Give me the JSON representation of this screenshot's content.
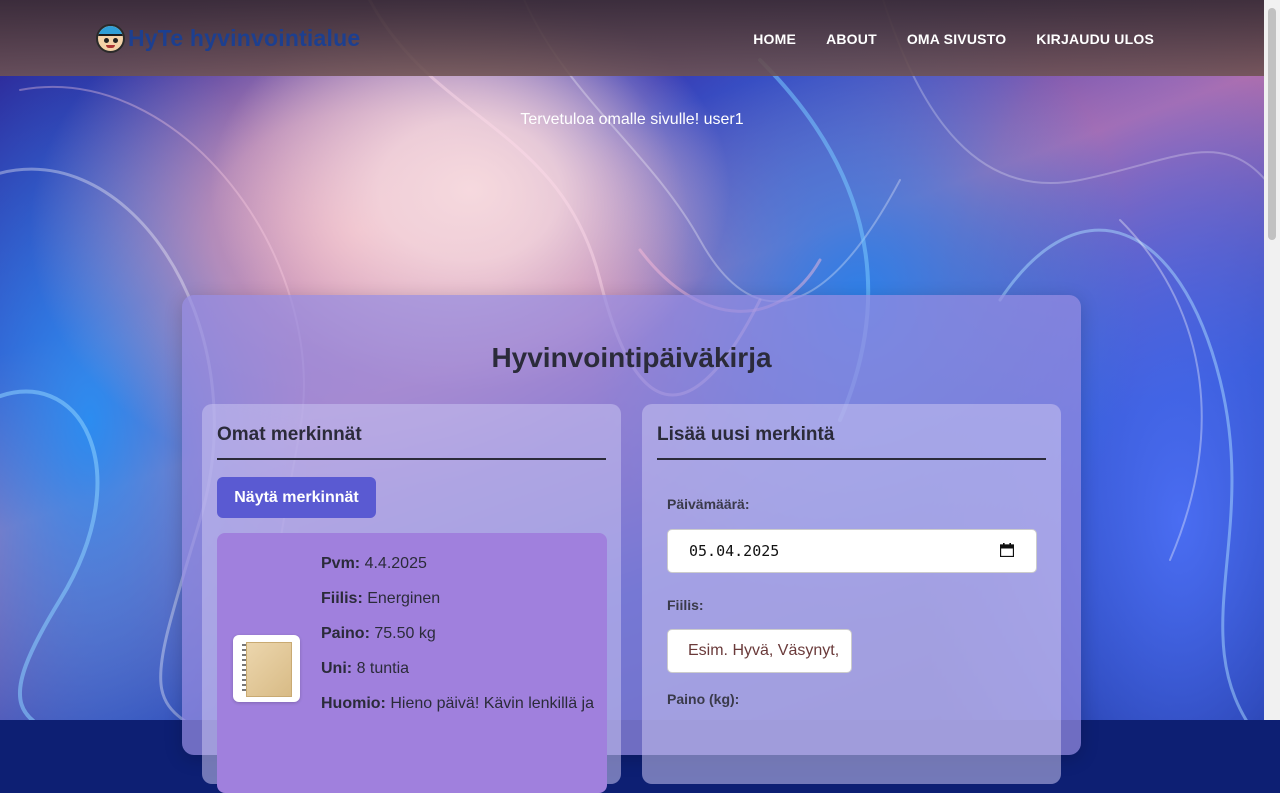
{
  "header": {
    "logo_text": "HyTe hyvinvointialue",
    "nav": [
      "HOME",
      "ABOUT",
      "OMA SIVUSTO",
      "KIRJAUDU ULOS"
    ]
  },
  "welcome": "Tervetuloa omalle sivulle! user1",
  "main": {
    "title": "Hyvinvointipäiväkirja",
    "entries_panel": {
      "title": "Omat merkinnät",
      "show_button": "Näytä merkinnät",
      "entry": {
        "fields": [
          {
            "label": "Pvm:",
            "value": "4.4.2025"
          },
          {
            "label": "Fiilis:",
            "value": "Energinen"
          },
          {
            "label": "Paino:",
            "value": "75.50 kg"
          },
          {
            "label": "Uni:",
            "value": "8 tuntia"
          },
          {
            "label": "Huomio:",
            "value": "Hieno päivä! Kävin lenkillä ja"
          }
        ]
      }
    },
    "new_entry_panel": {
      "title": "Lisää uusi merkintä",
      "date_label": "Päivämäärä:",
      "date_value": "05.04.2025",
      "mood_label": "Fiilis:",
      "mood_placeholder": "Esim. Hyvä, Väsynyt,",
      "weight_label": "Paino (kg):"
    }
  }
}
